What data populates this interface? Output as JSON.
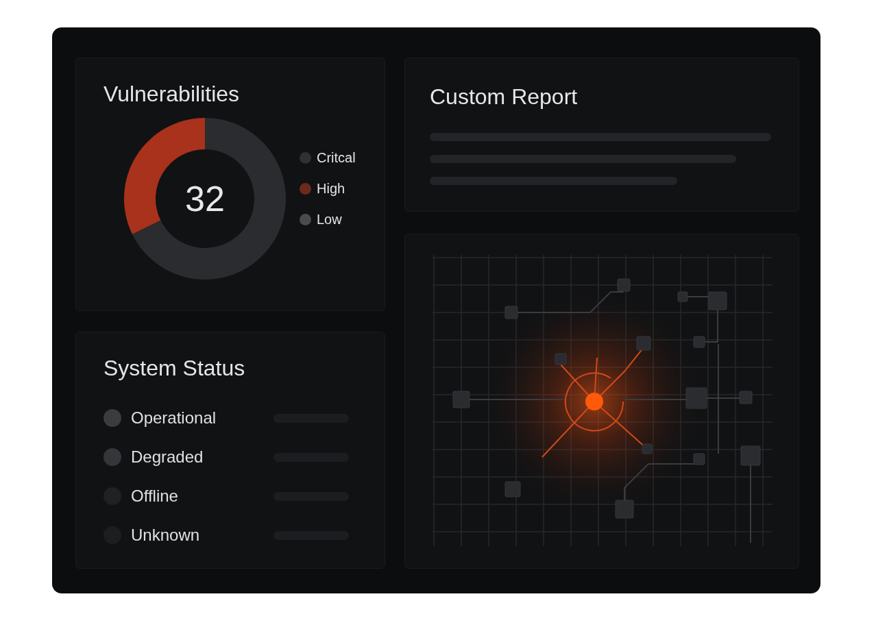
{
  "vulnerabilities": {
    "title": "Vulnerabilities",
    "total": "32",
    "legend": [
      {
        "label": "Critcal",
        "color": "#2e3034"
      },
      {
        "label": "High",
        "color": "#6b2a1a"
      },
      {
        "label": "Low",
        "color": "#4a4b4e"
      }
    ]
  },
  "custom_report": {
    "title": "Custom Report"
  },
  "system_status": {
    "title": "System Status",
    "items": [
      {
        "label": "Operational",
        "color": "#3a3c40"
      },
      {
        "label": "Degraded",
        "color": "#34363a"
      },
      {
        "label": "Offline",
        "color": "#1f2123"
      },
      {
        "label": "Unknown",
        "color": "#1c1e20"
      }
    ]
  }
}
